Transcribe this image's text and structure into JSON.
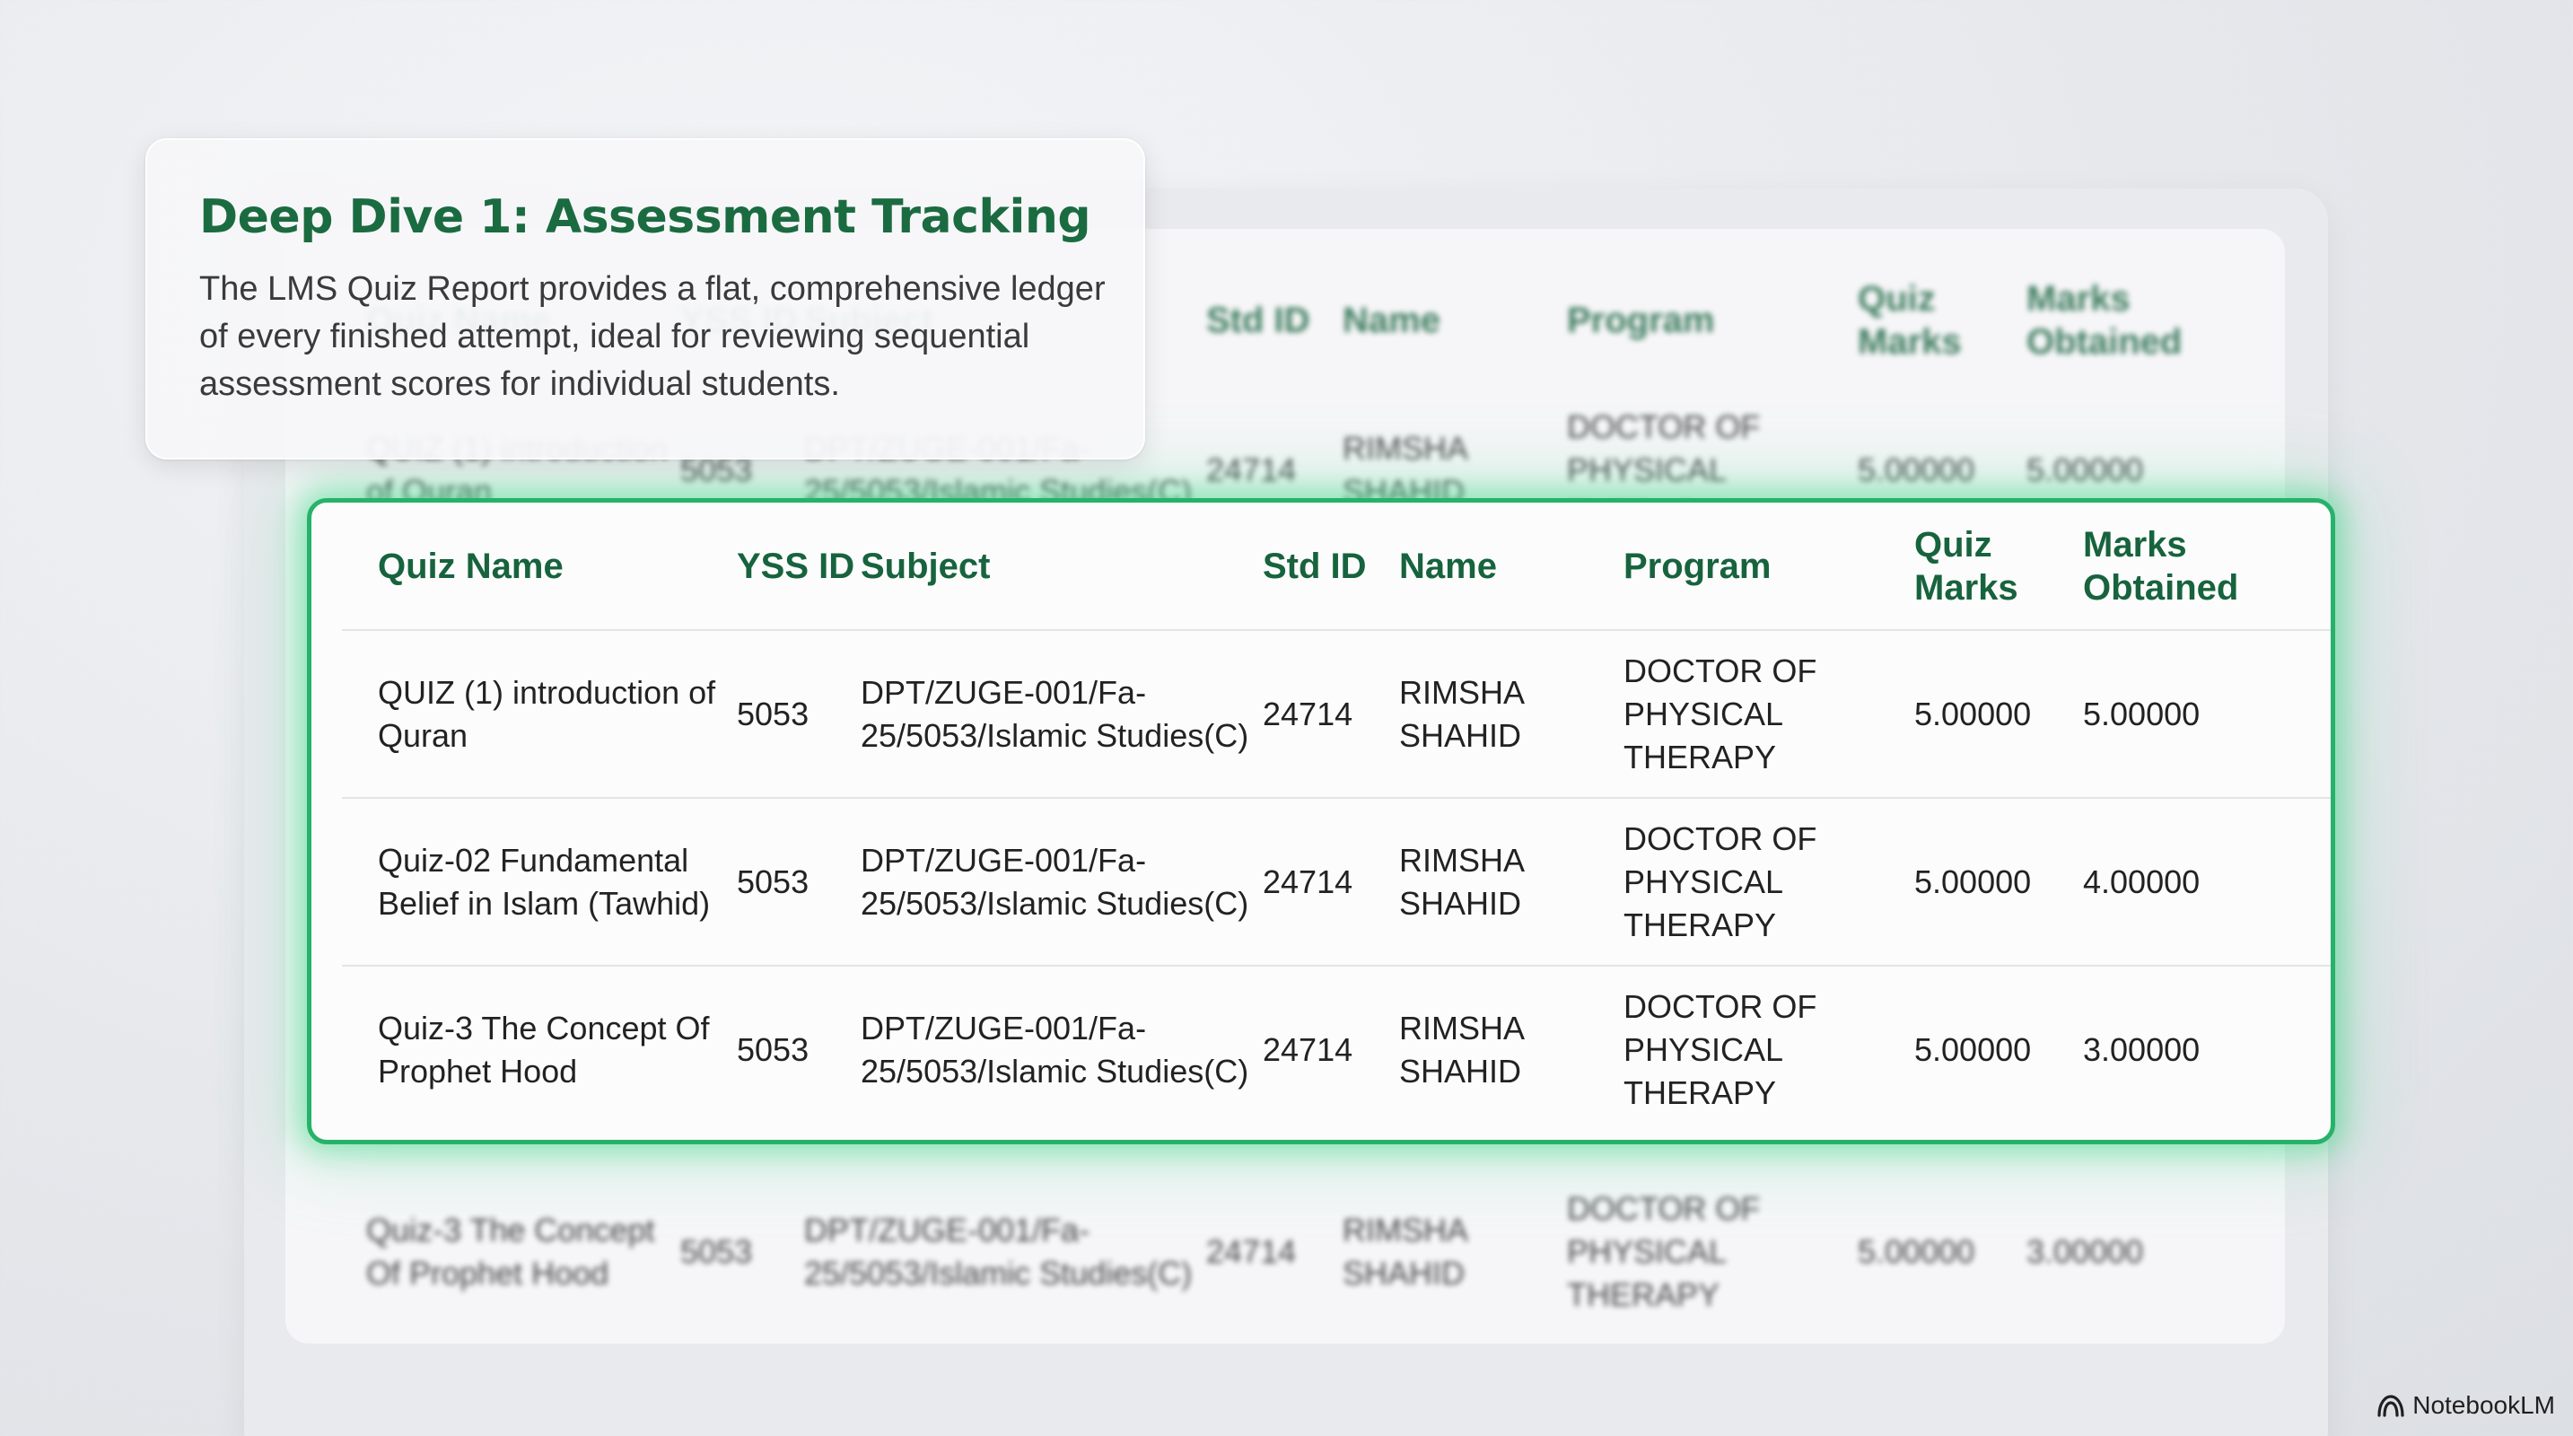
{
  "card": {
    "title": "Deep Dive 1: Assessment Tracking",
    "description": "The LMS Quiz Report provides a flat, comprehensive ledger of every finished attempt, ideal for reviewing sequential assessment scores for individual students."
  },
  "table": {
    "headers": {
      "quiz_name": "Quiz Name",
      "yss_id": "YSS ID",
      "subject": "Subject",
      "std_id": "Std ID",
      "name": "Name",
      "program": "Program",
      "quiz_marks": "Quiz Marks",
      "marks_obtained": "Marks Obtained"
    },
    "rows": [
      {
        "quiz_name": "QUIZ (1) introduction of Quran",
        "yss_id": "5053",
        "subject": "DPT/ZUGE-001/Fa-25/5053/Islamic Studies(C)",
        "std_id": "24714",
        "name": "RIMSHA SHAHID",
        "program": "DOCTOR OF PHYSICAL THERAPY",
        "quiz_marks": "5.00000",
        "marks_obtained": "5.00000"
      },
      {
        "quiz_name": "Quiz-02 Fundamental Belief in Islam (Tawhid)",
        "yss_id": "5053",
        "subject": "DPT/ZUGE-001/Fa-25/5053/Islamic Studies(C)",
        "std_id": "24714",
        "name": "RIMSHA SHAHID",
        "program": "DOCTOR OF PHYSICAL THERAPY",
        "quiz_marks": "5.00000",
        "marks_obtained": "4.00000"
      },
      {
        "quiz_name": "Quiz-3 The Concept Of Prophet Hood",
        "yss_id": "5053",
        "subject": "DPT/ZUGE-001/Fa-25/5053/Islamic Studies(C)",
        "std_id": "24714",
        "name": "RIMSHA SHAHID",
        "program": "DOCTOR OF PHYSICAL THERAPY",
        "quiz_marks": "5.00000",
        "marks_obtained": "3.00000"
      }
    ]
  },
  "brand": {
    "label": "NotebookLM",
    "icon": "notebooklm-logo-icon"
  },
  "colors": {
    "accent_green": "#1b6b41",
    "highlight_border": "#27b26a"
  }
}
